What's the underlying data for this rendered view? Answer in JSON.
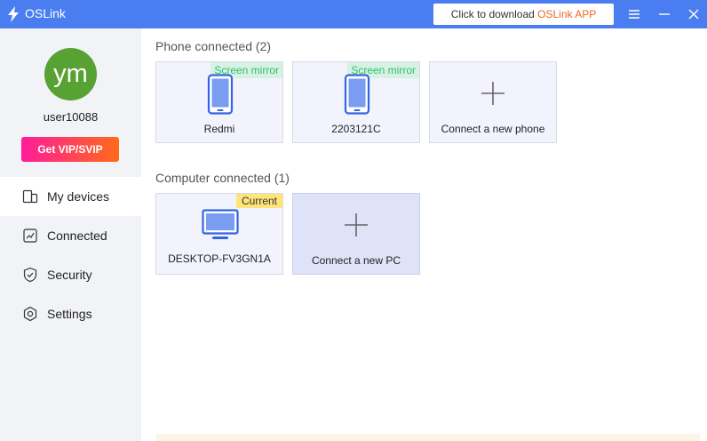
{
  "app": {
    "title": "OSLink"
  },
  "download": {
    "prefix": "Click to download ",
    "brand": "OSLink APP",
    "brand_color": "#f0661e"
  },
  "colors": {
    "titlebar": "#4a7ef0",
    "sidebar": "#f2f3f7",
    "avatar": "#58a233",
    "mirror_badge": "#2fbf6a",
    "current_badge": "#ffe47a"
  },
  "user": {
    "initials": "ym",
    "name": "user10088",
    "vip_label": "Get VIP/SVIP"
  },
  "nav": [
    {
      "label": "My devices",
      "icon": "devices-icon",
      "active": true
    },
    {
      "label": "Connected",
      "icon": "connected-icon",
      "active": false
    },
    {
      "label": "Security",
      "icon": "shield-icon",
      "active": false
    },
    {
      "label": "Settings",
      "icon": "gear-icon",
      "active": false
    }
  ],
  "phones": {
    "title": "Phone connected (2)",
    "devices": [
      {
        "name": "Redmi",
        "badge": "Screen mirror"
      },
      {
        "name": "2203121C",
        "badge": "Screen mirror"
      }
    ],
    "add_label": "Connect a new phone"
  },
  "computers": {
    "title": "Computer connected (1)",
    "devices": [
      {
        "name": "DESKTOP-FV3GN1A",
        "badge": "Current"
      }
    ],
    "add_label": "Connect a new PC"
  }
}
